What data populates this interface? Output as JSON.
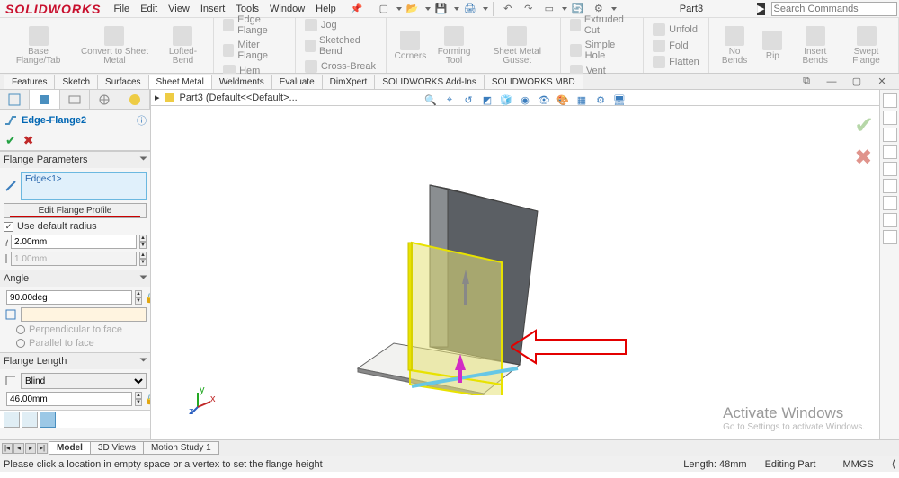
{
  "app": {
    "logo_text": "SOLIDWORKS",
    "doc_name": "Part3",
    "search_placeholder": "Search Commands"
  },
  "menus": [
    "File",
    "Edit",
    "View",
    "Insert",
    "Tools",
    "Window",
    "Help"
  ],
  "ribbon": {
    "large_dim": [
      "Base Flange/Tab",
      "Convert to Sheet Metal",
      "Lofted-Bend"
    ],
    "col1": [
      "Edge Flange",
      "Miter Flange",
      "Hem"
    ],
    "col2": [
      "Jog",
      "Sketched Bend",
      "Cross-Break"
    ],
    "large2": [
      "Corners",
      "Forming Tool",
      "Sheet Metal Gusset"
    ],
    "col3": [
      "Extruded Cut",
      "Simple Hole",
      "Vent"
    ],
    "col4": [
      "Unfold",
      "Fold",
      "Flatten"
    ],
    "large3": [
      "No Bends",
      "Rip",
      "Insert Bends",
      "Swept Flange"
    ]
  },
  "cmdtabs": [
    "Features",
    "Sketch",
    "Surfaces",
    "Sheet Metal",
    "Weldments",
    "Evaluate",
    "DimXpert",
    "SOLIDWORKS Add-Ins",
    "SOLIDWORKS MBD"
  ],
  "feature_tree_top": "Part3  (Default<<Default>...",
  "pm": {
    "title": "Edge-Flange2",
    "flange_params_header": "Flange Parameters",
    "edge_sel": "Edge<1>",
    "edit_profile": "Edit Flange Profile",
    "use_default_radius": "Use default radius",
    "radius1": "2.00mm",
    "radius2": "1.00mm",
    "angle_header": "Angle",
    "angle_val": "90.00deg",
    "perpendicular": "Perpendicular to face",
    "parallel": "Parallel to face",
    "length_header": "Flange Length",
    "length_type": "Blind",
    "length_val": "46.00mm"
  },
  "bottom_tabs": [
    "Model",
    "3D Views",
    "Motion Study 1"
  ],
  "status": {
    "hint": "Please click a location in empty space or a vertex to set the flange height",
    "length": "Length: 48mm",
    "mode": "Editing Part",
    "units": "MMGS"
  },
  "watermark": {
    "l1": "Activate Windows",
    "l2": "Go to Settings to activate Windows."
  },
  "triad": {
    "x": "x",
    "y": "y",
    "z": "z"
  }
}
